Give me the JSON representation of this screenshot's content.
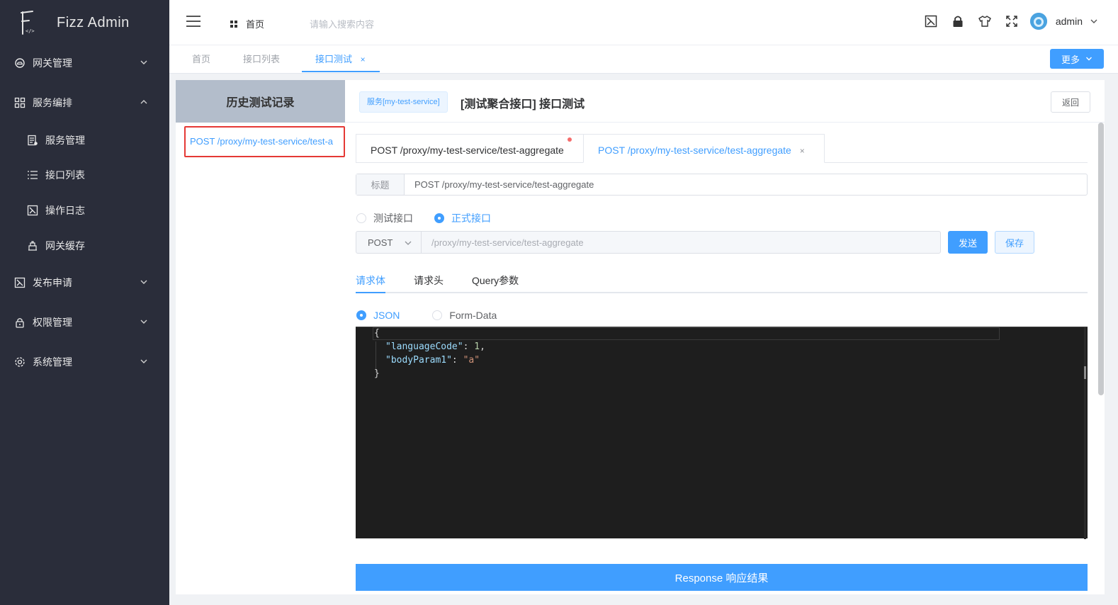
{
  "app": {
    "title": "Fizz Admin"
  },
  "sidebar": {
    "items": [
      {
        "label": "网关管理",
        "icon": "cloud-icon",
        "expanded": false
      },
      {
        "label": "服务编排",
        "icon": "grid-icon",
        "expanded": true
      },
      {
        "label": "服务管理",
        "icon": "server-icon"
      },
      {
        "label": "接口列表",
        "icon": "list-icon"
      },
      {
        "label": "操作日志",
        "icon": "log-icon"
      },
      {
        "label": "网关缓存",
        "icon": "cache-icon"
      },
      {
        "label": "发布申请",
        "icon": "publish-icon",
        "expanded": false
      },
      {
        "label": "权限管理",
        "icon": "lock-icon",
        "expanded": false
      },
      {
        "label": "系统管理",
        "icon": "gear-icon",
        "expanded": false
      }
    ]
  },
  "header": {
    "breadcrumb": "首页",
    "search_placeholder": "请输入搜索内容",
    "username": "admin"
  },
  "tabs": {
    "items": [
      {
        "label": "首页",
        "active": false
      },
      {
        "label": "接口列表",
        "active": false
      },
      {
        "label": "接口测试",
        "active": true,
        "close": "×"
      }
    ],
    "more_label": "更多"
  },
  "history": {
    "title": "历史测试记录",
    "items": [
      "POST /proxy/my-test-service/test-a"
    ]
  },
  "panel": {
    "service_tag": "服务[my-test-service]",
    "title": "[测试聚合接口] 接口测试",
    "back_label": "返回",
    "request_tabs": [
      {
        "label": "POST /proxy/my-test-service/test-aggregate",
        "active": false,
        "has_dot": true
      },
      {
        "label": "POST /proxy/my-test-service/test-aggregate",
        "active": true,
        "close": "×"
      }
    ],
    "title_label": "标题",
    "title_value": "POST /proxy/my-test-service/test-aggregate",
    "mode_options": [
      {
        "label": "测试接口",
        "selected": false
      },
      {
        "label": "正式接口",
        "selected": true
      }
    ],
    "method": "POST",
    "url_placeholder": "/proxy/my-test-service/test-aggregate",
    "send_label": "发送",
    "save_label": "保存",
    "body_tabs": [
      {
        "label": "请求体",
        "active": true
      },
      {
        "label": "请求头",
        "active": false
      },
      {
        "label": "Query参数",
        "active": false
      }
    ],
    "body_types": [
      {
        "label": "JSON",
        "selected": true
      },
      {
        "label": "Form-Data",
        "selected": false
      }
    ],
    "editor": {
      "open_brace": "{",
      "key1": "\"languageCode\"",
      "val1": "1",
      "key2": "\"bodyParam1\"",
      "val2": "\"a\"",
      "close_brace": "}"
    },
    "response_label": "Response 响应结果"
  },
  "colors": {
    "accent": "#409eff",
    "sidebar_bg": "#2a2d3a",
    "highlight_border": "#e53935"
  }
}
